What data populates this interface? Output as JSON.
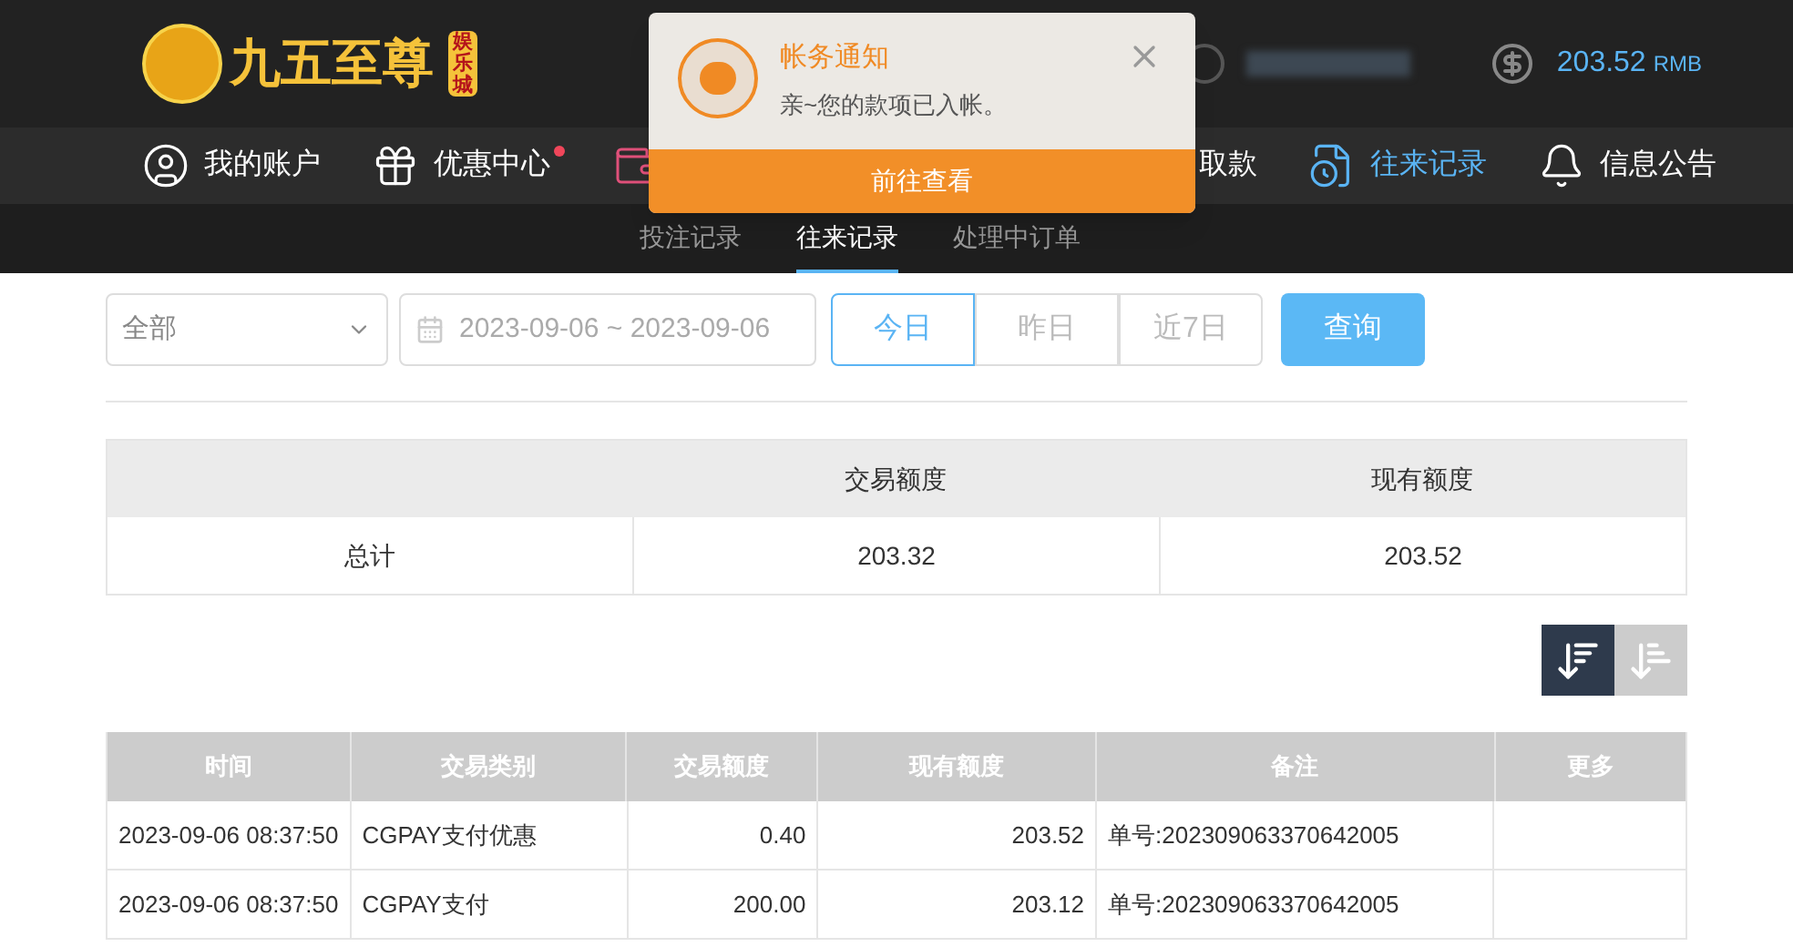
{
  "header": {
    "logo_text": "九五至尊",
    "logo_badge": "娱乐城",
    "balance": "203.52",
    "currency": "RMB"
  },
  "nav": [
    {
      "label": "我的账户",
      "selected": false,
      "dot": false
    },
    {
      "label": "优惠中心",
      "selected": false,
      "dot": true
    },
    {
      "label": "取款",
      "selected": false,
      "dot": false
    },
    {
      "label": "往来记录",
      "selected": true,
      "dot": false
    },
    {
      "label": "信息公告",
      "selected": false,
      "dot": false
    }
  ],
  "subtabs": [
    {
      "label": "投注记录",
      "selected": false
    },
    {
      "label": "往来记录",
      "selected": true
    },
    {
      "label": "处理中订单",
      "selected": false
    }
  ],
  "notification": {
    "title": "帐务通知",
    "message": "亲~您的款项已入帐。",
    "action": "前往查看"
  },
  "filter": {
    "type_select": "全部",
    "date_range": "2023-09-06 ~ 2023-09-06",
    "quick": [
      {
        "label": "今日",
        "selected": true
      },
      {
        "label": "昨日",
        "selected": false
      },
      {
        "label": "近7日",
        "selected": false
      }
    ],
    "query": "查询"
  },
  "summary": {
    "columns": [
      "",
      "交易额度",
      "现有额度"
    ],
    "rows": [
      [
        "总计",
        "203.32",
        "203.52"
      ]
    ]
  },
  "sort": [
    {
      "selected": true
    },
    {
      "selected": false
    }
  ],
  "table": {
    "columns": [
      "时间",
      "交易类别",
      "交易额度",
      "现有额度",
      "备注",
      "更多"
    ],
    "rows": [
      [
        "2023-09-06 08:37:50",
        "CGPAY支付优惠",
        "0.40",
        "203.52",
        "单号:202309063370642005",
        ""
      ],
      [
        "2023-09-06 08:37:50",
        "CGPAY支付",
        "200.00",
        "203.12",
        "单号:202309063370642005",
        ""
      ]
    ]
  }
}
